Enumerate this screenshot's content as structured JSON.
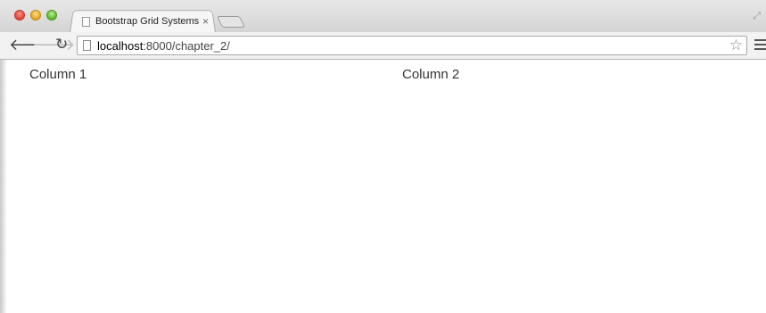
{
  "browser": {
    "tab_title": "Bootstrap Grid Systems",
    "tab_close": "×",
    "url_host": "localhost",
    "url_rest": ":8000/chapter_2/"
  },
  "icons": {
    "back": "back-arrow-icon",
    "forward": "forward-arrow-icon",
    "reload": "reload-icon",
    "star": "star-icon",
    "menu": "hamburger-menu-icon"
  },
  "page": {
    "columns": [
      "Column 1",
      "Column 2"
    ]
  }
}
